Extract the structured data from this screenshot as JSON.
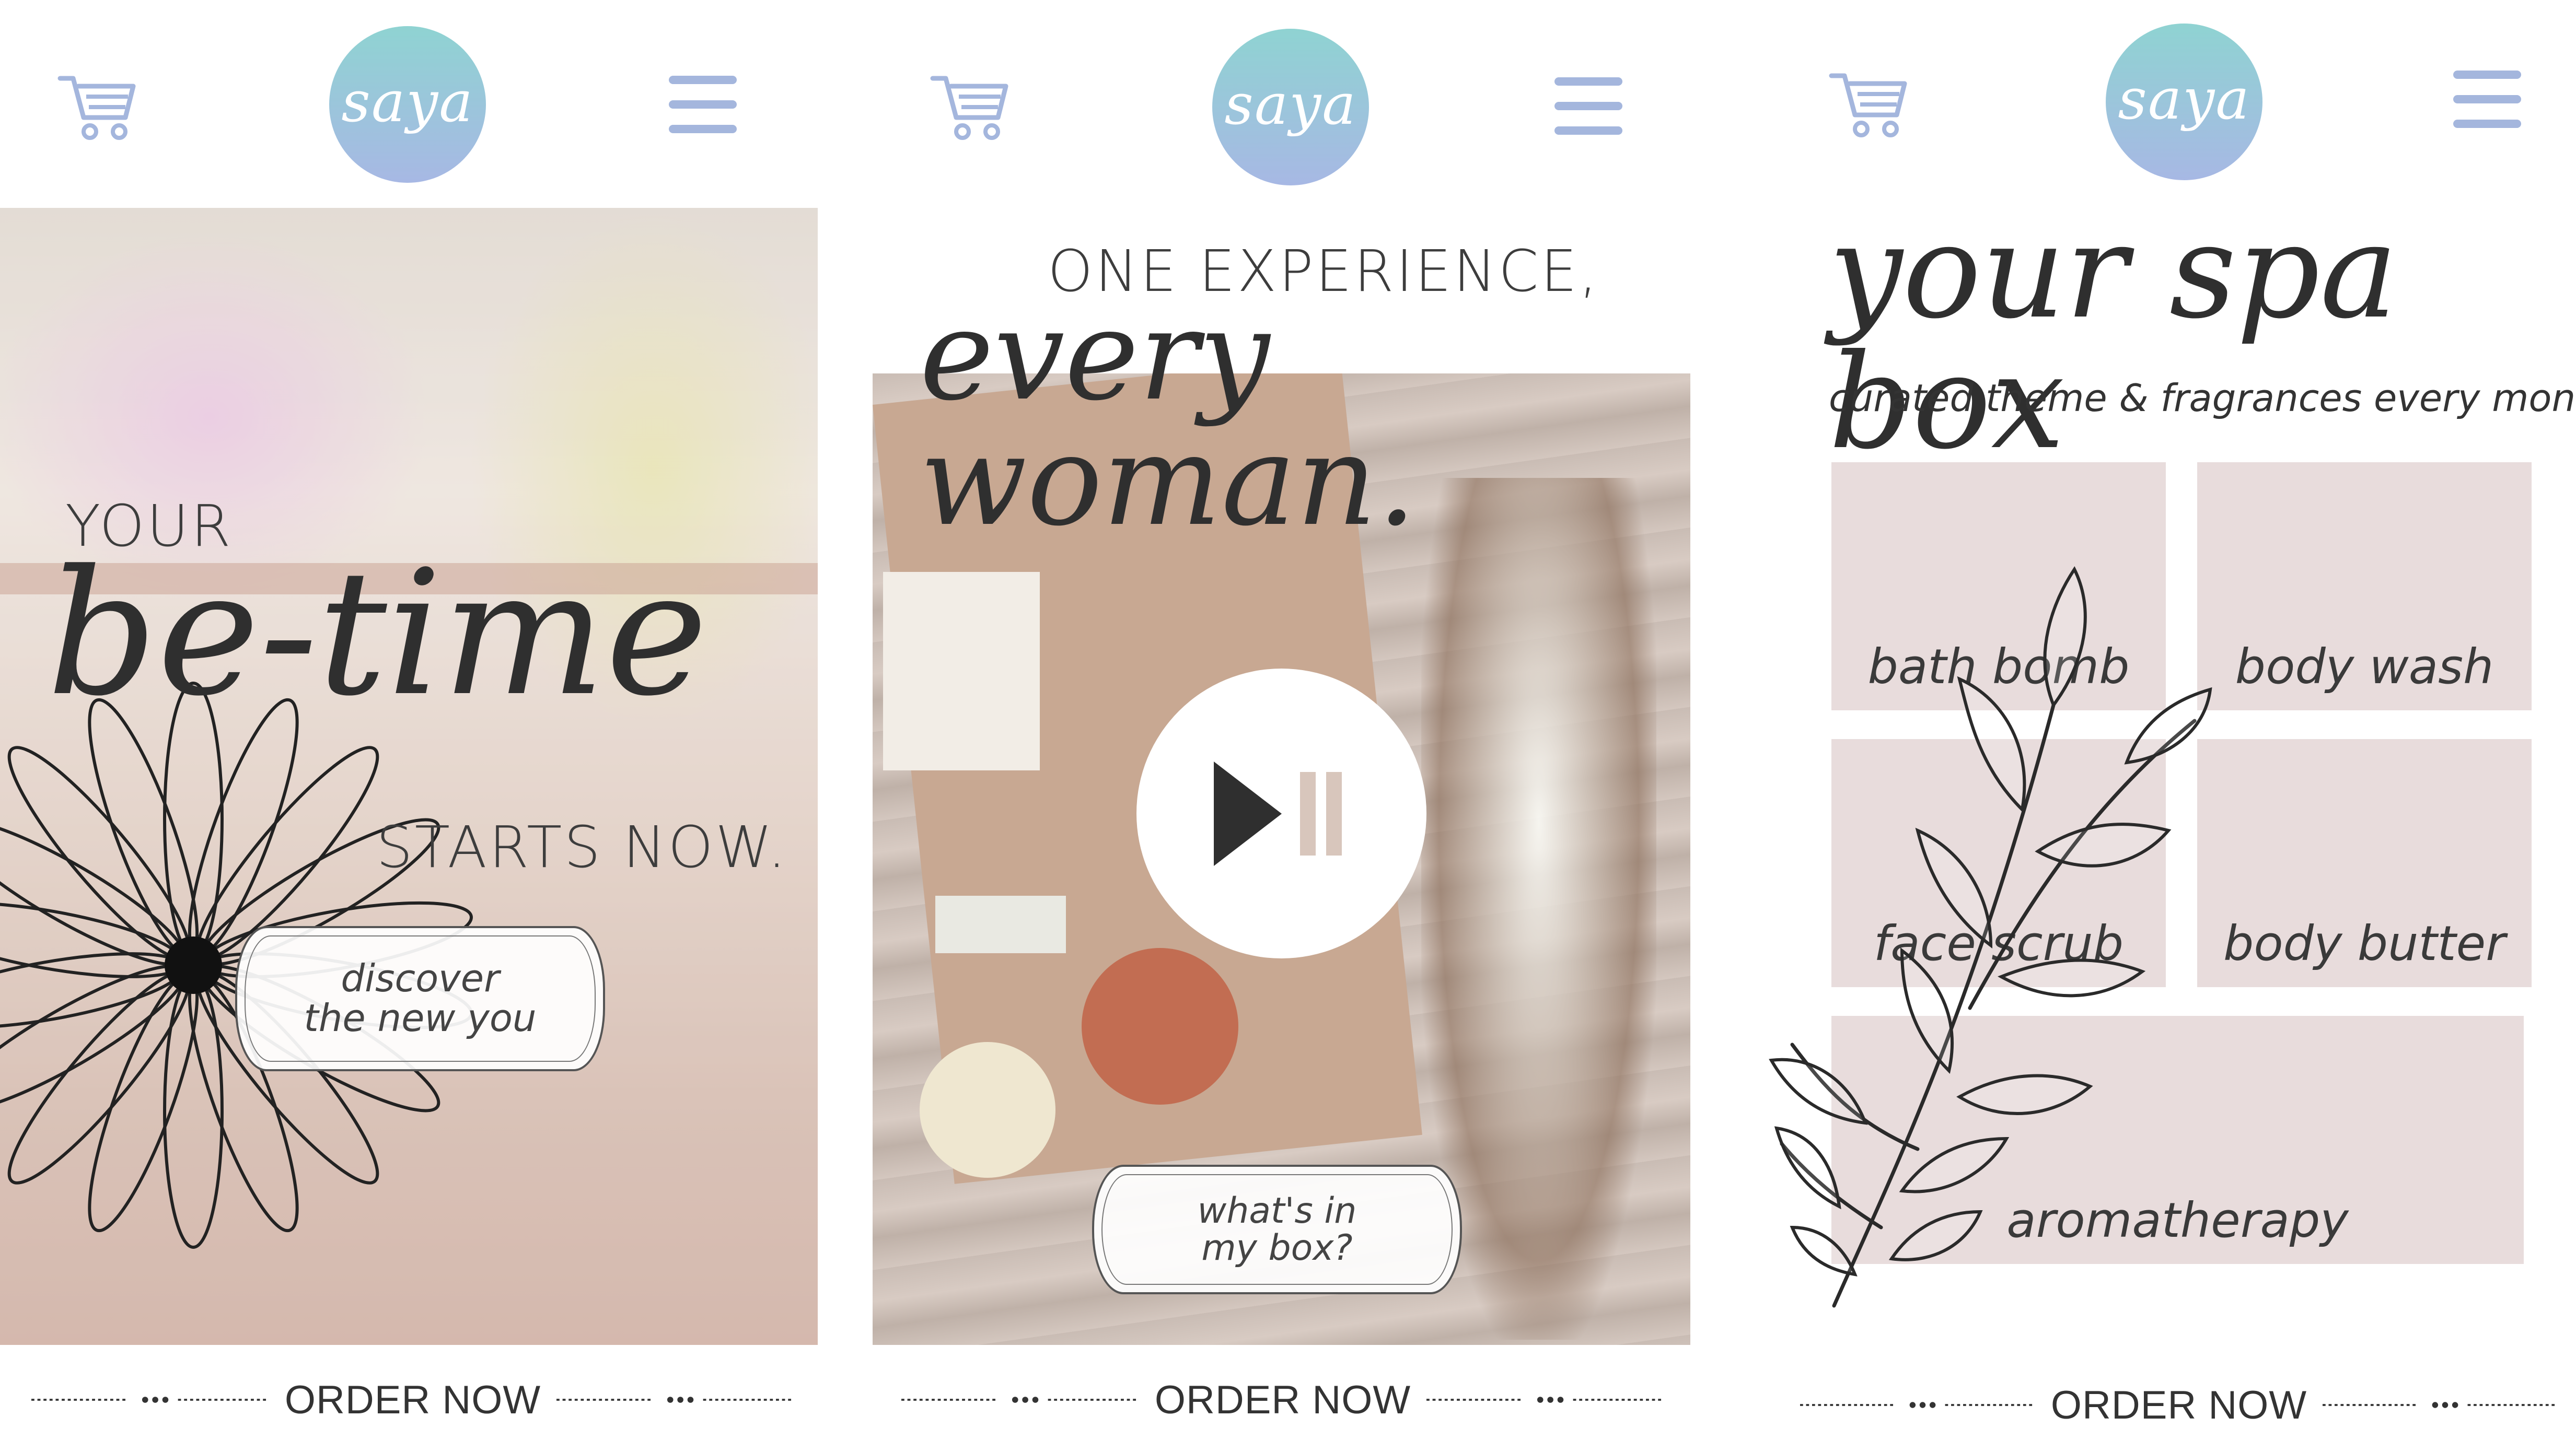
{
  "brand": {
    "logo_text": "saya",
    "logo_colors": [
      "#8fd3d2",
      "#a7b8e4"
    ]
  },
  "icons": {
    "cart": "cart-icon",
    "menu": "hamburger-menu-icon",
    "play": "play-pause-icon"
  },
  "screen1": {
    "headline_small": "YOUR",
    "headline_script": "be-time",
    "headline_tail": "STARTS NOW.",
    "cta_line1": "discover",
    "cta_line2": "the new you",
    "order_label": "ORDER NOW"
  },
  "screen2": {
    "headline_caps": "ONE EXPERIENCE,",
    "headline_script": "every woman.",
    "cta_line1": "what's in",
    "cta_line2": "my box?",
    "order_label": "ORDER NOW"
  },
  "screen3": {
    "title_script": "your spa box",
    "subtitle": "curated theme & fragrances every month",
    "tiles": [
      "bath bomb",
      "body wash",
      "face scrub",
      "body butter",
      "aromatherapy"
    ],
    "order_label": "ORDER NOW"
  },
  "colors": {
    "accent": "#a4b6dd",
    "tile": "#e8dcdc",
    "text": "#333333"
  }
}
